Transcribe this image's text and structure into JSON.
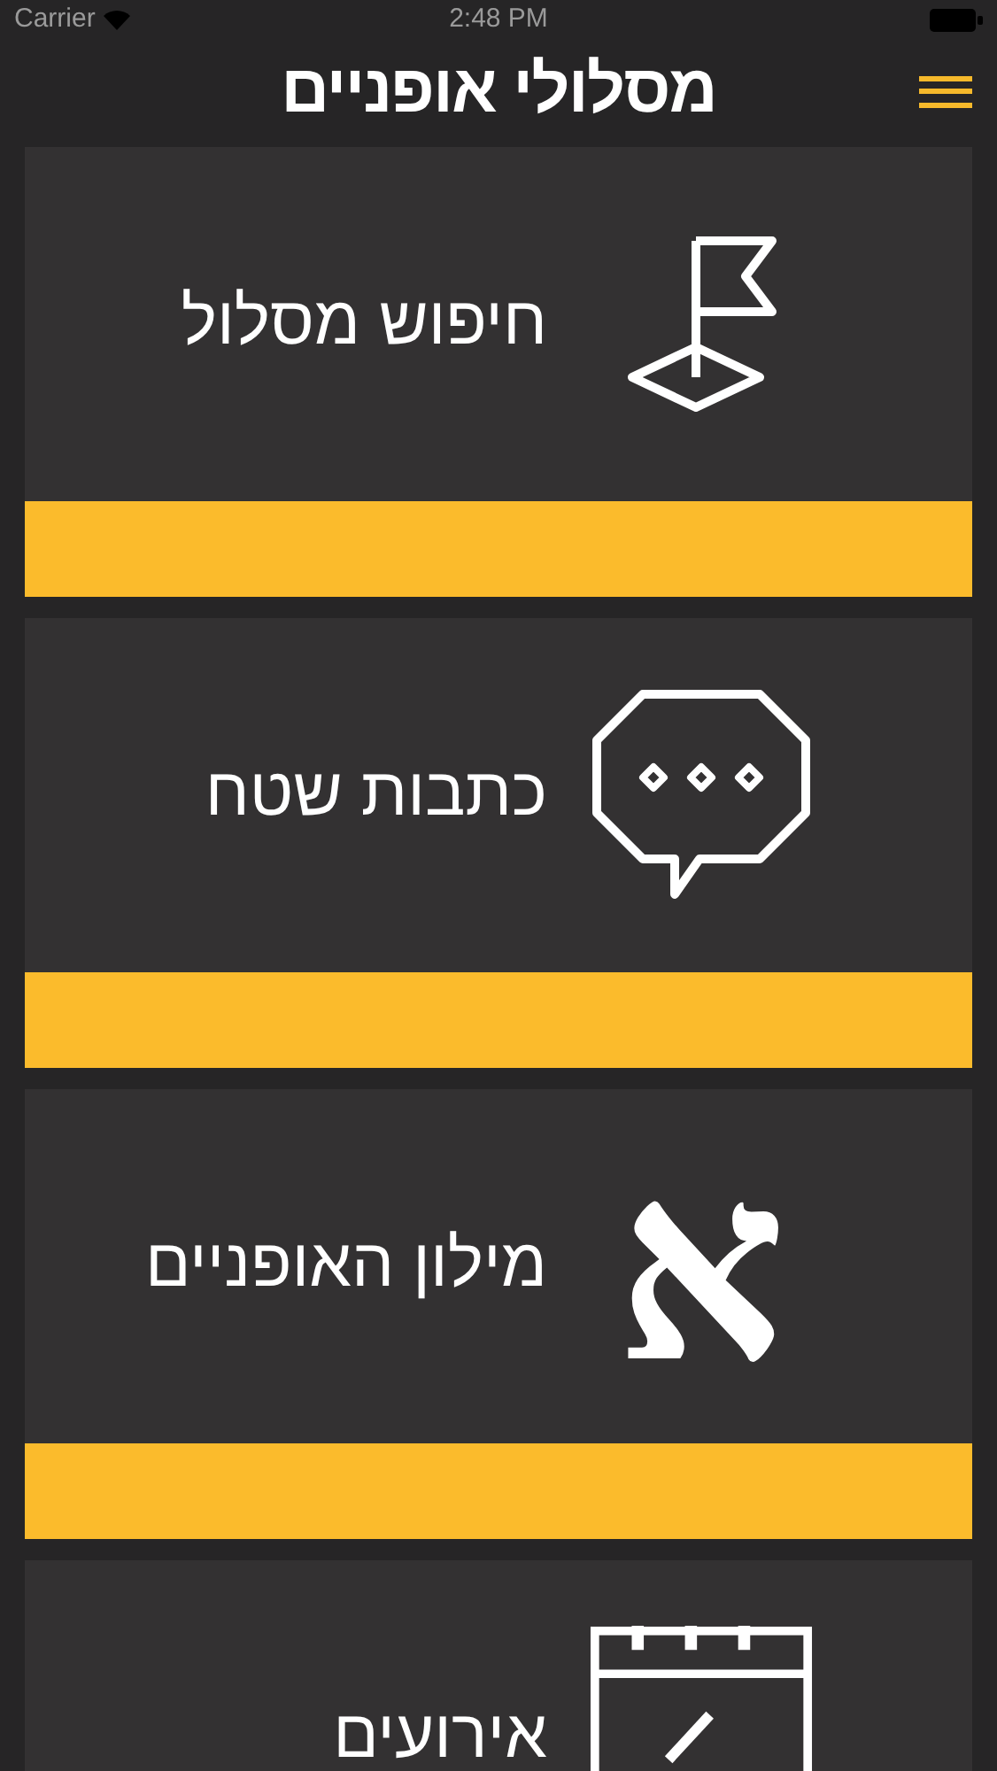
{
  "status_bar": {
    "carrier": "Carrier",
    "time": "2:48 PM"
  },
  "header": {
    "title": "מסלולי אופניים"
  },
  "cards": [
    {
      "label": "חיפוש מסלול",
      "kind": "flag",
      "accent_bar": true
    },
    {
      "label": "כתבות שטח",
      "kind": "chat",
      "accent_bar": true
    },
    {
      "label": "מילון האופניים",
      "kind": "letter",
      "glyph": "א",
      "accent_bar": true
    },
    {
      "label": "אירועים",
      "kind": "calendar",
      "accent_bar": false
    }
  ]
}
